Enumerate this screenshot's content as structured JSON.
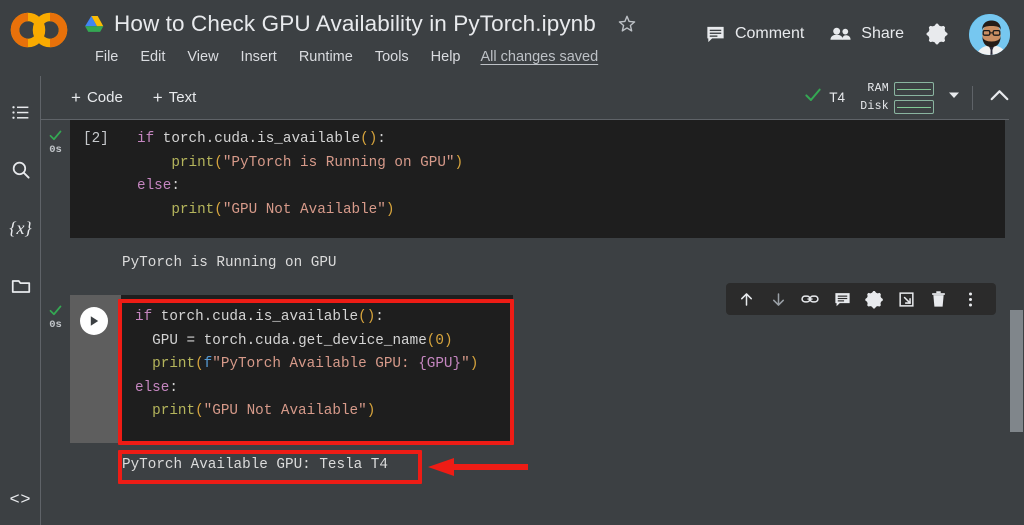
{
  "window": {
    "app_name": "Colab",
    "notebook_title": "How to Check GPU Availability in PyTorch.ipynb",
    "saved_status": "All changes saved"
  },
  "header": {
    "logo_icon": "colab-co-logo",
    "drive_icon": "google-drive-icon",
    "star_icon": "star-outline-icon",
    "menu": [
      {
        "label": "File",
        "name": "menu-file"
      },
      {
        "label": "Edit",
        "name": "menu-edit"
      },
      {
        "label": "View",
        "name": "menu-view"
      },
      {
        "label": "Insert",
        "name": "menu-insert"
      },
      {
        "label": "Runtime",
        "name": "menu-runtime"
      },
      {
        "label": "Tools",
        "name": "menu-tools"
      },
      {
        "label": "Help",
        "name": "menu-help"
      }
    ],
    "comment_label": "Comment",
    "comment_icon": "comment-icon",
    "share_label": "Share",
    "share_icon": "people-share-icon",
    "gear_icon": "settings-gear-icon",
    "avatar_icon": "user-avatar"
  },
  "toolbar": {
    "add_code_label": "Code",
    "add_text_label": "Text",
    "add_icon": "plus-icon",
    "connection": {
      "status_icon": "green-check-icon",
      "runtime_label": "T4",
      "ram_label": "RAM",
      "disk_label": "Disk",
      "caret_icon": "chevron-down-icon"
    },
    "collapse_icon": "chevron-up-icon"
  },
  "sidebar": {
    "items": [
      {
        "name": "sidebar-item-table-of-contents",
        "icon": "list-toc-icon"
      },
      {
        "name": "sidebar-item-find-replace",
        "icon": "search-icon"
      },
      {
        "name": "sidebar-item-variables",
        "icon": "variables-braces-icon",
        "glyph": "{x}"
      },
      {
        "name": "sidebar-item-files",
        "icon": "folder-icon"
      }
    ],
    "bottom_item": {
      "name": "sidebar-item-code-snippets",
      "icon": "code-brackets-icon",
      "glyph": "<>"
    }
  },
  "notebook": {
    "cells": [
      {
        "id": "cell-1",
        "prompt": "[2]",
        "status_icon": "green-check-icon",
        "elapsed": "0s",
        "code_lines": [
          [
            {
              "t": "kw",
              "v": "if"
            },
            {
              "t": "sp",
              "v": " "
            },
            {
              "t": "id",
              "v": "torch.cuda.is_available"
            },
            {
              "t": "par",
              "v": "()"
            },
            {
              "t": "op",
              "v": ":"
            }
          ],
          [
            {
              "t": "sp",
              "v": "    "
            },
            {
              "t": "fn",
              "v": "print"
            },
            {
              "t": "par",
              "v": "("
            },
            {
              "t": "str",
              "v": "\"PyTorch is Running on GPU\""
            },
            {
              "t": "par",
              "v": ")"
            }
          ],
          [
            {
              "t": "kw",
              "v": "else"
            },
            {
              "t": "op",
              "v": ":"
            }
          ],
          [
            {
              "t": "sp",
              "v": "    "
            },
            {
              "t": "fn",
              "v": "print"
            },
            {
              "t": "par",
              "v": "("
            },
            {
              "t": "str",
              "v": "\"GPU Not Available\""
            },
            {
              "t": "par",
              "v": ")"
            }
          ]
        ],
        "output": "PyTorch is Running on GPU"
      },
      {
        "id": "cell-2",
        "prompt": "",
        "status_icon": "green-check-icon",
        "elapsed": "0s",
        "run_button_icon": "play-icon",
        "code_lines": [
          [
            {
              "t": "kw",
              "v": "if"
            },
            {
              "t": "sp",
              "v": " "
            },
            {
              "t": "id",
              "v": "torch.cuda.is_available"
            },
            {
              "t": "par",
              "v": "()"
            },
            {
              "t": "op",
              "v": ":"
            }
          ],
          [
            {
              "t": "sp",
              "v": "  "
            },
            {
              "t": "id",
              "v": "GPU"
            },
            {
              "t": "sp",
              "v": " "
            },
            {
              "t": "op",
              "v": "="
            },
            {
              "t": "sp",
              "v": " "
            },
            {
              "t": "id",
              "v": "torch.cuda.get_device_name"
            },
            {
              "t": "par",
              "v": "("
            },
            {
              "t": "num",
              "v": "0"
            },
            {
              "t": "par",
              "v": ")"
            }
          ],
          [
            {
              "t": "sp",
              "v": "  "
            },
            {
              "t": "fn",
              "v": "print"
            },
            {
              "t": "par",
              "v": "("
            },
            {
              "t": "fpfx",
              "v": "f"
            },
            {
              "t": "str",
              "v": "\"PyTorch Available GPU: "
            },
            {
              "t": "brc",
              "v": "{GPU}"
            },
            {
              "t": "str",
              "v": "\""
            },
            {
              "t": "par",
              "v": ")"
            }
          ],
          [
            {
              "t": "kw",
              "v": "else"
            },
            {
              "t": "op",
              "v": ":"
            }
          ],
          [
            {
              "t": "sp",
              "v": "  "
            },
            {
              "t": "fn",
              "v": "print"
            },
            {
              "t": "par",
              "v": "("
            },
            {
              "t": "str",
              "v": "\"GPU Not Available\""
            },
            {
              "t": "par",
              "v": ")"
            }
          ]
        ],
        "output": "PyTorch Available GPU: Tesla T4"
      }
    ],
    "cell_toolbar": [
      {
        "name": "move-cell-up-button",
        "icon": "arrow-up-icon"
      },
      {
        "name": "move-cell-down-button",
        "icon": "arrow-down-icon"
      },
      {
        "name": "copy-cell-link-button",
        "icon": "link-icon"
      },
      {
        "name": "add-comment-button",
        "icon": "comment-icon"
      },
      {
        "name": "cell-settings-button",
        "icon": "gear-icon"
      },
      {
        "name": "mirror-cell-button",
        "icon": "open-in-new-icon"
      },
      {
        "name": "delete-cell-button",
        "icon": "trash-icon"
      },
      {
        "name": "more-cell-actions-button",
        "icon": "kebab-menu-icon"
      }
    ]
  },
  "annotations": {
    "code_highlight": {
      "name": "code-highlight-box",
      "color": "#EE1C15"
    },
    "output_highlight": {
      "name": "output-highlight-box",
      "color": "#EE1C15"
    },
    "pointer_arrow": {
      "name": "red-pointer-arrow",
      "color": "#EE1C15"
    }
  },
  "colors": {
    "chrome_bg": "#3c4043",
    "code_bg": "#1e1e1e",
    "accent_red": "#EE1C15",
    "accent_green": "#34a853",
    "colab_orange": "#F9AB00",
    "text_primary": "#e8eaed"
  },
  "scrollbar": {
    "name": "vertical-scrollbar",
    "thumb_color": "#80868b"
  }
}
